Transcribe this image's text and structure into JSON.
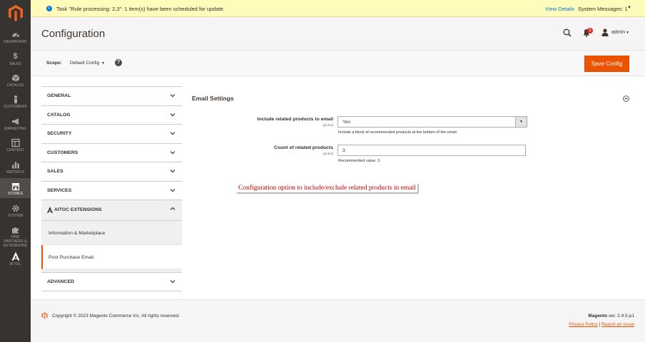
{
  "menu": {
    "items": [
      {
        "label": "DASHBOARD",
        "icon": "dashboard-icon"
      },
      {
        "label": "SALES",
        "icon": "dollar-icon"
      },
      {
        "label": "CATALOG",
        "icon": "cube-icon"
      },
      {
        "label": "CUSTOMERS",
        "icon": "person-icon"
      },
      {
        "label": "MARKETING",
        "icon": "megaphone-icon"
      },
      {
        "label": "CONTENT",
        "icon": "layout-icon"
      },
      {
        "label": "REPORTS",
        "icon": "bar-chart-icon"
      },
      {
        "label": "STORES",
        "icon": "store-icon"
      },
      {
        "label": "SYSTEM",
        "icon": "gear-icon"
      },
      {
        "label": "FIND PARTNERS & EXTENSIONS",
        "icon": "puzzle-icon"
      },
      {
        "label": "AITOC",
        "icon": "aitoc-logo-icon"
      }
    ]
  },
  "sysbar": {
    "message": "Task \"Rule processing: 2,3\": 1 item(s) have been scheduled for update.",
    "view_details": "View Details",
    "system_messages": "System Messages: 1"
  },
  "header": {
    "title": "Configuration",
    "notifications_count": "1",
    "user": "admin"
  },
  "scope": {
    "label": "Scope:",
    "value": "Default Config",
    "help": "?",
    "save_label": "Save Config"
  },
  "tabs": {
    "general": "GENERAL",
    "catalog": "CATALOG",
    "security": "SECURITY",
    "customers": "CUSTOMERS",
    "sales": "SALES",
    "services": "SERVICES",
    "aitoc": "AITOC EXTENSIONS",
    "sub_info": "Information & Marketplace",
    "sub_ppe": "Post Purchase Email",
    "advanced": "ADVANCED"
  },
  "section": {
    "title": "Email Settings",
    "field1": {
      "label": "Include related products to email",
      "scope": "[global]",
      "value": "Yes",
      "note": "Include a block of recommended products at the bottom of the email."
    },
    "field2": {
      "label": "Count of related products",
      "scope": "[global]",
      "value": "3",
      "note": "Recommended value: 3."
    }
  },
  "annotation": "Configuration option to include/exclude related products in email",
  "footer": {
    "copyright": "Copyright © 2023 Magento Commerce Inc. All rights reserved.",
    "brand": "Magento",
    "version": "ver. 2.4.5-p1",
    "privacy": "Privacy Policy",
    "separator": "|",
    "report": "Report an Issue"
  },
  "colors": {
    "accent": "#eb5202",
    "menu_bg": "#373330",
    "link": "#007bdb",
    "annotation": "#c00000"
  }
}
